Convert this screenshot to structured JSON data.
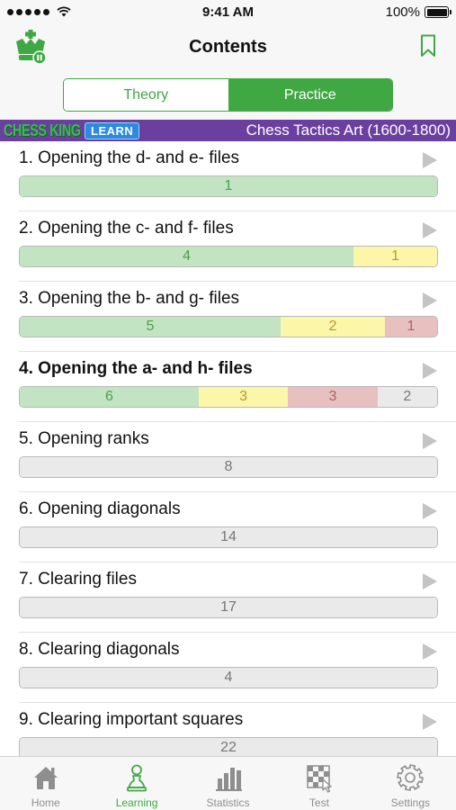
{
  "status_bar": {
    "time": "9:41 AM",
    "battery": "100%"
  },
  "header": {
    "title": "Contents"
  },
  "segmented_control": {
    "options": [
      {
        "label": "Theory",
        "selected": false
      },
      {
        "label": "Practice",
        "selected": true
      }
    ]
  },
  "banner": {
    "brand": "CHESS KING",
    "badge": "LEARN",
    "course_title": "Chess Tactics Art (1600-1800)"
  },
  "colors": {
    "accent": "#3fa843",
    "banner_bg": "#6b3fa0",
    "progress_solved": "#c2e4c2",
    "progress_partial": "#fcf6a8",
    "progress_failed": "#e8c0c0",
    "progress_unsolved": "#eaeaea"
  },
  "items": [
    {
      "title": "1. Opening the d- and e- files",
      "bold": false,
      "progress": {
        "green": 1,
        "yellow": 0,
        "red": 0,
        "gray": 0
      }
    },
    {
      "title": "2. Opening the c- and f- files",
      "bold": false,
      "progress": {
        "green": 4,
        "yellow": 1,
        "red": 0,
        "gray": 0
      }
    },
    {
      "title": "3. Opening the b- and g- files",
      "bold": false,
      "progress": {
        "green": 5,
        "yellow": 2,
        "red": 1,
        "gray": 0
      }
    },
    {
      "title": "4. Opening the a- and h- files",
      "bold": true,
      "progress": {
        "green": 6,
        "yellow": 3,
        "red": 3,
        "gray": 2
      }
    },
    {
      "title": "5. Opening ranks",
      "bold": false,
      "progress": {
        "green": 0,
        "yellow": 0,
        "red": 0,
        "gray": 8
      }
    },
    {
      "title": "6. Opening diagonals",
      "bold": false,
      "progress": {
        "green": 0,
        "yellow": 0,
        "red": 0,
        "gray": 14
      }
    },
    {
      "title": "7. Clearing files",
      "bold": false,
      "progress": {
        "green": 0,
        "yellow": 0,
        "red": 0,
        "gray": 17
      }
    },
    {
      "title": "8. Clearing diagonals",
      "bold": false,
      "progress": {
        "green": 0,
        "yellow": 0,
        "red": 0,
        "gray": 4
      }
    },
    {
      "title": "9. Clearing important squares",
      "bold": false,
      "progress": {
        "green": 0,
        "yellow": 0,
        "red": 0,
        "gray": 22
      }
    }
  ],
  "tab_bar": {
    "tabs": [
      {
        "label": "Home",
        "icon": "home-icon",
        "active": false
      },
      {
        "label": "Learning",
        "icon": "pawn-icon",
        "active": true
      },
      {
        "label": "Statistics",
        "icon": "bar-chart-icon",
        "active": false
      },
      {
        "label": "Test",
        "icon": "checkered-board-icon",
        "active": false
      },
      {
        "label": "Settings",
        "icon": "gear-icon",
        "active": false
      }
    ]
  }
}
